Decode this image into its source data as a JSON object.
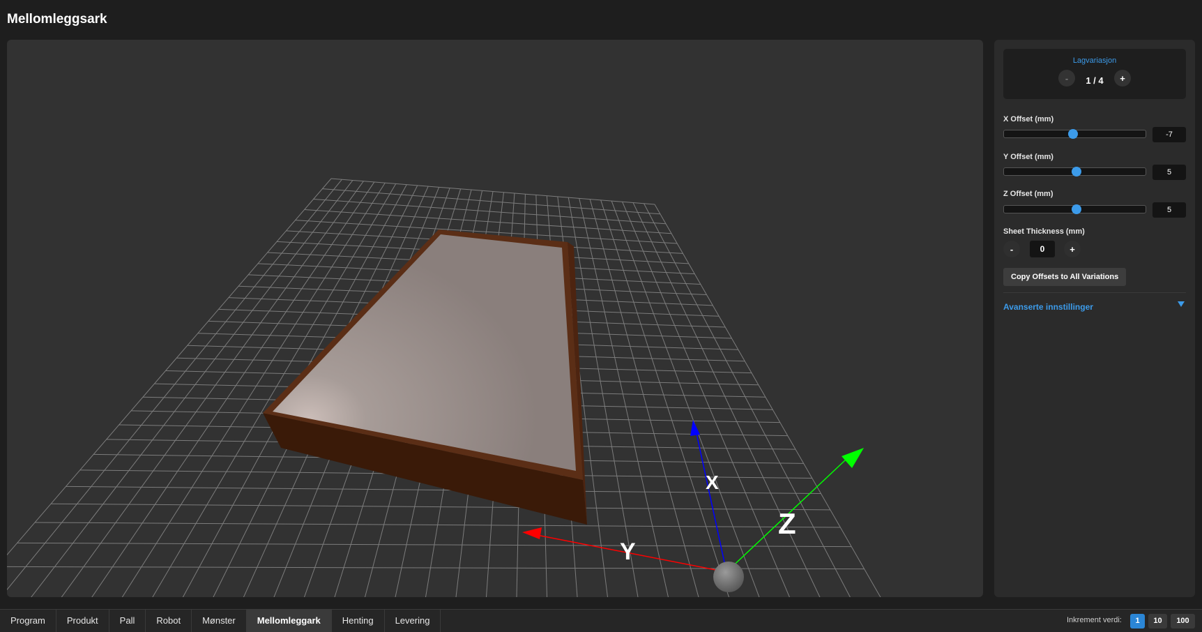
{
  "header": {
    "title": "Mellomleggsark"
  },
  "viewport": {
    "axis_labels": {
      "x": "X",
      "y": "Y",
      "z": "Z"
    },
    "colors": {
      "x_axis": "#0000ff",
      "y_axis": "#ff0000",
      "z_axis": "#00ff00",
      "sheet_top": "#a39a97",
      "pallet": "#4a2410",
      "grid": "#8a8a8a"
    }
  },
  "panel": {
    "variation": {
      "label": "Lagvariasjon",
      "value": "1 / 4",
      "minus": "-",
      "plus": "+"
    },
    "x_offset": {
      "label": "X Offset (mm)",
      "value": "-7",
      "slider_fraction": 0.49
    },
    "y_offset": {
      "label": "Y Offset (mm)",
      "value": "5",
      "slider_fraction": 0.51
    },
    "z_offset": {
      "label": "Z Offset (mm)",
      "value": "5",
      "slider_fraction": 0.51
    },
    "thickness": {
      "label": "Sheet Thickness (mm)",
      "value": "0",
      "minus": "-",
      "plus": "+"
    },
    "copy_button": "Copy Offsets to All Variations",
    "advanced": {
      "label": "Avanserte innstillinger"
    }
  },
  "bottom": {
    "tabs": [
      {
        "label": "Program",
        "active": false
      },
      {
        "label": "Produkt",
        "active": false
      },
      {
        "label": "Pall",
        "active": false
      },
      {
        "label": "Robot",
        "active": false
      },
      {
        "label": "Mønster",
        "active": false
      },
      {
        "label": "Mellomleggark",
        "active": true
      },
      {
        "label": "Henting",
        "active": false
      },
      {
        "label": "Levering",
        "active": false
      }
    ],
    "increment": {
      "label": "Inkrement verdi:",
      "options": [
        "1",
        "10",
        "100"
      ],
      "selected": "1"
    }
  }
}
